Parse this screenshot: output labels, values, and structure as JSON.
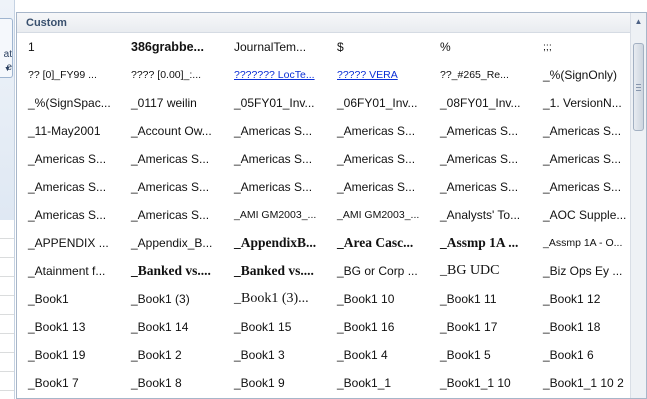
{
  "ribbon": {
    "label": "at",
    "sublabel": "e"
  },
  "gallery": {
    "group_title": "Custom",
    "cells": [
      {
        "text": "1",
        "style": ""
      },
      {
        "text": "386grabbe...",
        "style": "bold"
      },
      {
        "text": "JournalTem...",
        "style": ""
      },
      {
        "text": "$",
        "style": ""
      },
      {
        "text": "%",
        "style": ""
      },
      {
        "text": ";;;",
        "style": "small"
      },
      {
        "text": "?? [0]_FY99 ...",
        "style": "small"
      },
      {
        "text": "???? [0.00]_:...",
        "style": "small"
      },
      {
        "text": "??????? LocTe...",
        "style": "link"
      },
      {
        "text": "????? VERA",
        "style": "link"
      },
      {
        "text": "??_#265_Re...",
        "style": "small"
      },
      {
        "text": "_%(SignOnly)",
        "style": ""
      },
      {
        "text": "_%(SignSpac...",
        "style": ""
      },
      {
        "text": "_0117 weilin",
        "style": ""
      },
      {
        "text": "_05FY01_Inv...",
        "style": ""
      },
      {
        "text": "_06FY01_Inv...",
        "style": ""
      },
      {
        "text": "_08FY01_Inv...",
        "style": ""
      },
      {
        "text": "_1. VersionN...",
        "style": ""
      },
      {
        "text": "_11-May2001",
        "style": ""
      },
      {
        "text": "_Account Ow...",
        "style": ""
      },
      {
        "text": "_Americas S...",
        "style": ""
      },
      {
        "text": "_Americas S...",
        "style": ""
      },
      {
        "text": "_Americas S...",
        "style": ""
      },
      {
        "text": "_Americas S...",
        "style": ""
      },
      {
        "text": "_Americas S...",
        "style": ""
      },
      {
        "text": "_Americas S...",
        "style": ""
      },
      {
        "text": "_Americas S...",
        "style": ""
      },
      {
        "text": "_Americas S...",
        "style": ""
      },
      {
        "text": "_Americas S...",
        "style": ""
      },
      {
        "text": "_Americas S...",
        "style": ""
      },
      {
        "text": "_Americas S...",
        "style": ""
      },
      {
        "text": "_Americas S...",
        "style": ""
      },
      {
        "text": "_Americas S...",
        "style": ""
      },
      {
        "text": "_Americas S...",
        "style": ""
      },
      {
        "text": "_Americas S...",
        "style": ""
      },
      {
        "text": "_Americas S...",
        "style": ""
      },
      {
        "text": "_Americas S...",
        "style": ""
      },
      {
        "text": "_Americas S...",
        "style": ""
      },
      {
        "text": "_AMI GM2003_...",
        "style": "small"
      },
      {
        "text": "_AMI GM2003_...",
        "style": "small"
      },
      {
        "text": "_Analysts' To...",
        "style": ""
      },
      {
        "text": "_AOC Supple...",
        "style": ""
      },
      {
        "text": "_APPENDIX ...",
        "style": ""
      },
      {
        "text": "_Appendix_B...",
        "style": ""
      },
      {
        "text": "_AppendixB...",
        "style": "serif-bold"
      },
      {
        "text": "_Area Casc...",
        "style": "serif-bold"
      },
      {
        "text": "_Assmp 1A ...",
        "style": "serif-bold"
      },
      {
        "text": "_Assmp 1A - O...",
        "style": "small"
      },
      {
        "text": "_Atainment f...",
        "style": ""
      },
      {
        "text": "_Banked vs....",
        "style": "serif-bold"
      },
      {
        "text": "_Banked vs....",
        "style": "serif-bold"
      },
      {
        "text": "_BG or Corp ...",
        "style": ""
      },
      {
        "text": "_BG UDC",
        "style": "serif"
      },
      {
        "text": "_Biz Ops Ey ...",
        "style": ""
      },
      {
        "text": "_Book1",
        "style": ""
      },
      {
        "text": "_Book1 (3)",
        "style": ""
      },
      {
        "text": "_Book1 (3)...",
        "style": "serif"
      },
      {
        "text": "_Book1 10",
        "style": ""
      },
      {
        "text": "_Book1 11",
        "style": ""
      },
      {
        "text": "_Book1 12",
        "style": ""
      },
      {
        "text": "_Book1 13",
        "style": ""
      },
      {
        "text": "_Book1 14",
        "style": ""
      },
      {
        "text": "_Book1 15",
        "style": ""
      },
      {
        "text": "_Book1 16",
        "style": ""
      },
      {
        "text": "_Book1 17",
        "style": ""
      },
      {
        "text": "_Book1 18",
        "style": ""
      },
      {
        "text": "_Book1 19",
        "style": ""
      },
      {
        "text": "_Book1 2",
        "style": ""
      },
      {
        "text": "_Book1 3",
        "style": ""
      },
      {
        "text": "_Book1 4",
        "style": ""
      },
      {
        "text": "_Book1 5",
        "style": ""
      },
      {
        "text": "_Book1 6",
        "style": ""
      },
      {
        "text": "_Book1 7",
        "style": ""
      },
      {
        "text": "_Book1 8",
        "style": ""
      },
      {
        "text": "_Book1 9",
        "style": ""
      },
      {
        "text": "_Book1_1",
        "style": ""
      },
      {
        "text": "_Book1_1 10",
        "style": ""
      },
      {
        "text": "_Book1_1 10 2",
        "style": ""
      }
    ]
  }
}
